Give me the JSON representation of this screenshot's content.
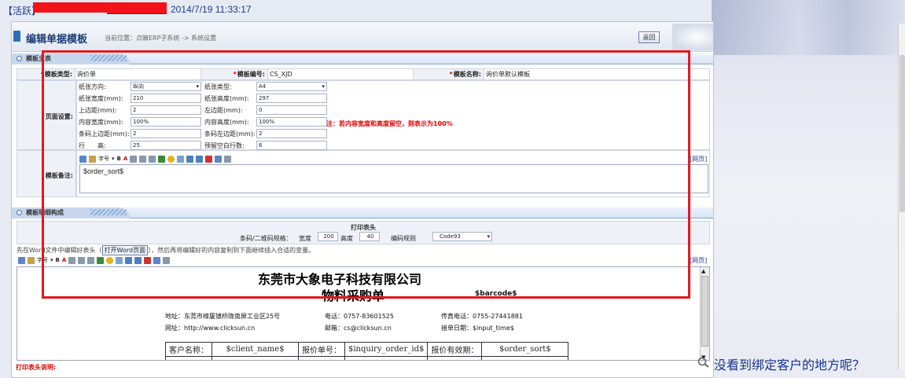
{
  "status": {
    "tag": "【活跃】",
    "datetime": "2014/7/19 11:33:17"
  },
  "header": {
    "title": "编辑单据模板",
    "breadcrumb": "当前位置：点睛ERP子系统 -> 系统设置",
    "back_label": "返回"
  },
  "template_section": {
    "title": "模板主表",
    "type_label": "模板类型:",
    "type_value": "询价单",
    "code_label": "模板编号:",
    "code_value": "CS_XJD",
    "name_label": "模板名称:",
    "name_value": "询价单默认模板",
    "page_label": "页面设置:",
    "remark_label": "模板备注:",
    "remark_value": "$order_sort$",
    "page_settings": {
      "orientation_label": "纸张方向:",
      "orientation_value": "纵向",
      "paper_type_label": "纸张类型:",
      "paper_type_value": "A4",
      "paper_width_label": "纸张宽度(mm):",
      "paper_width_value": "210",
      "paper_height_label": "纸张高度(mm):",
      "paper_height_value": "297",
      "top_margin_label": "上边距(mm):",
      "top_margin_value": "2",
      "left_margin_label": "左边距(mm):",
      "left_margin_value": "0",
      "content_width_label": "内容宽度(mm):",
      "content_width_value": "100%",
      "content_height_label": "内容高度(mm):",
      "content_height_value": "100%",
      "barcode_top_label": "条码上边距(mm):",
      "barcode_top_value": "2",
      "barcode_left_label": "条码左边距(mm):",
      "barcode_left_value": "2",
      "row_height_label": "行　　高:",
      "row_height_value": "25",
      "reserved_rows_label": "预留空白行数:",
      "reserved_rows_value": "6",
      "note": "注：若内容宽度和高度留空，则表示为100%"
    },
    "toolbar_font_label": "字号",
    "html_tag": "[网页]"
  },
  "detail_section": {
    "title": "模板明细构成",
    "print_header_title": "打印表头",
    "barcode_size_label": "条码/二维码规格：",
    "width_label": "宽度",
    "width_value": "200",
    "height_label": "高度",
    "height_value": "40",
    "encoding_label": "编码规则",
    "encoding_value": "Code93",
    "word_hint_prefix": "先在Word文件中编辑好表头（",
    "open_word_label": "打开Word页面",
    "word_hint_suffix": "），然后再将编辑好的内容复制到下面继续插入合适的变量。",
    "html_tag": "[网页]",
    "toolbar_font_label": "字号",
    "footer_label": "打印表头说明:"
  },
  "document": {
    "company": "东莞市大象电子科技有限公司",
    "doc_title": "物料采购单",
    "barcode_var": "$barcode$",
    "address": "地址：东莞市樟厦镇桥陇南屏工业区25号",
    "phone": "电话：0757-83601525",
    "fax": "传真电话：0755-27441881",
    "website": "网址：http://www.clicksun.cn",
    "email": "邮箱：cs@clicksun.cn",
    "date": "接单日期：$input_time$",
    "table_row": [
      "客户名称：",
      "$client_name$",
      "报价单号：",
      "$inquiry_order_id$",
      "报价有效期：",
      "$order_sort$"
    ]
  },
  "help": {
    "text": "没看到绑定客户的地方呢？"
  }
}
